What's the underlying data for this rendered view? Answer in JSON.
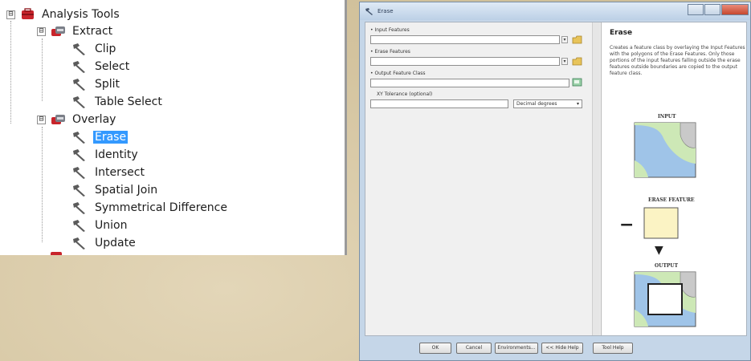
{
  "toolbox": {
    "root": {
      "label": "Analysis Tools",
      "expander": "⊟"
    },
    "groups": [
      {
        "label": "Extract",
        "expander": "⊟",
        "tools": [
          "Clip",
          "Select",
          "Split",
          "Table Select"
        ]
      },
      {
        "label": "Overlay",
        "expander": "⊟",
        "tools": [
          "Erase",
          "Identity",
          "Intersect",
          "Spatial Join",
          "Symmetrical Difference",
          "Union",
          "Update"
        ]
      }
    ],
    "selected_tool": "Erase"
  },
  "dialog": {
    "title": "Erase",
    "fields": [
      {
        "label": "• Input Features",
        "value": ""
      },
      {
        "label": "• Erase Features",
        "value": ""
      },
      {
        "label": "• Output Feature Class",
        "value": ""
      },
      {
        "label": "XY Tolerance (optional)",
        "value": "",
        "unit": "Decimal degrees"
      }
    ],
    "help": {
      "title": "Erase",
      "text": "Creates a feature class by overlaying the Input Features with the polygons of the Erase Features. Only those portions of the input features falling outside the erase features outside boundaries are copied to the output feature class.",
      "diagram": {
        "input_caption": "INPUT",
        "erase_caption": "ERASE FEATURE",
        "output_caption": "OUTPUT",
        "minus": "−",
        "arrow": "▼"
      }
    },
    "buttons": {
      "ok": "OK",
      "cancel": "Cancel",
      "environments": "Environments...",
      "hide_help": "<< Hide Help",
      "tool_help": "Tool Help"
    },
    "window_controls": {
      "minimize": "",
      "maximize": "",
      "close": ""
    }
  },
  "colors": {
    "selection": "#3399ff",
    "toolbox_red": "#c8242b",
    "map_green": "#cde8b6",
    "map_blue": "#9fc4e8",
    "map_gray": "#c9c9c9",
    "erase_yellow": "#fbf3c4"
  }
}
